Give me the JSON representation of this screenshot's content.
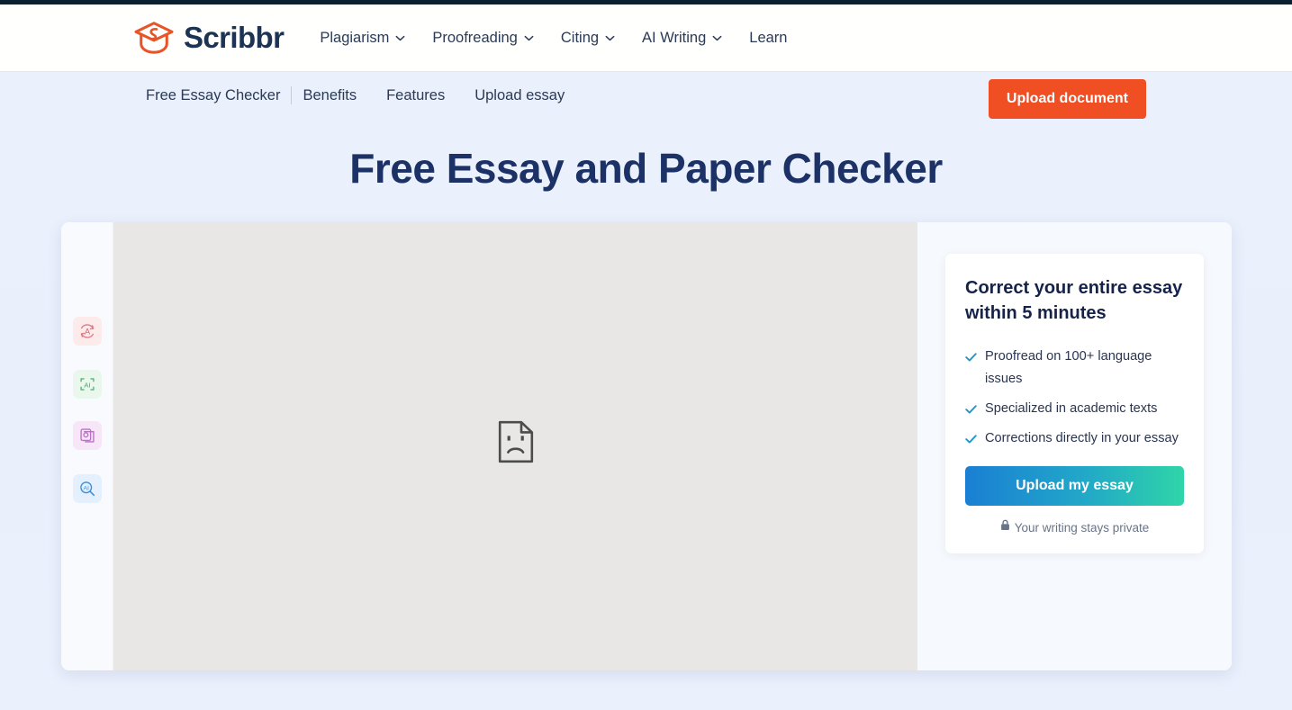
{
  "brand": {
    "name": "Scribbr",
    "logo_icon": "graduation-cap-icon",
    "logo_color": "#e8542a",
    "wordmark_color": "#1c3354"
  },
  "header": {
    "nav": [
      {
        "label": "Plagiarism",
        "has_dropdown": true
      },
      {
        "label": "Proofreading",
        "has_dropdown": true
      },
      {
        "label": "Citing",
        "has_dropdown": true
      },
      {
        "label": "AI Writing",
        "has_dropdown": true
      },
      {
        "label": "Learn",
        "has_dropdown": false
      }
    ]
  },
  "subnav": {
    "items": [
      {
        "label": "Free Essay Checker"
      },
      {
        "label": "Benefits"
      },
      {
        "label": "Features"
      },
      {
        "label": "Upload essay"
      }
    ],
    "upload_button": "Upload document",
    "upload_button_color": "#f04e23"
  },
  "main": {
    "page_title": "Free Essay and Paper Checker"
  },
  "editor": {
    "tools": [
      {
        "name": "grammar-check-tool",
        "glyph": "A",
        "bg": "#fdeaea",
        "color": "#e06b78"
      },
      {
        "name": "ai-proofreader-tool",
        "glyph": "AI",
        "bg": "#e9f7ec",
        "color": "#54ad6e"
      },
      {
        "name": "plagiarism-check-tool",
        "glyph": "C",
        "bg": "#f7e6f8",
        "color": "#b濃"
      },
      {
        "name": "ai-detector-tool",
        "glyph": "AI",
        "bg": "#e4f0fd",
        "color": "#3d8fdb"
      }
    ],
    "document_placeholder_icon": "empty-document-sad-face-icon",
    "document_bg": "#e8e7e5"
  },
  "promo": {
    "title": "Correct your entire essay within 5 minutes",
    "benefits": [
      "Proofread on 100+ language issues",
      "Specialized in academic texts",
      "Corrections directly in your essay"
    ],
    "check_icon": "check-icon",
    "check_color": "#2196c9",
    "cta_label": "Upload my essay",
    "cta_gradient_from": "#1a7fd4",
    "cta_gradient_to": "#2fd5a8",
    "privacy_icon": "lock-icon",
    "privacy_note": "Your writing stays private"
  }
}
